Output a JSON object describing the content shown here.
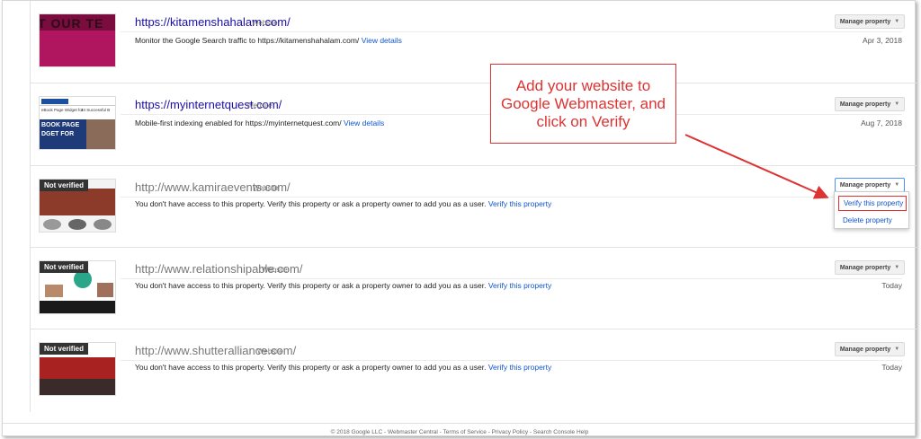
{
  "properties": [
    {
      "url": "https://kitamenshahalam.com/",
      "type": "Website",
      "verified": true,
      "message": "Monitor the Google Search traffic to https://kitamenshahalam.com/",
      "link": "View details",
      "date": "Apr 3, 2018",
      "button": "Manage property",
      "thumb_text": "T OUR TE"
    },
    {
      "url": "https://myinternetquest.com/",
      "type": "Website",
      "verified": true,
      "message": "Mobile-first indexing enabled for https://myinternetquest.com/",
      "link": "View details",
      "date": "Aug 7, 2018",
      "button": "Manage property",
      "thumb_text_1": "eBook Page Widget for",
      "thumb_text_2": "34 Successful B",
      "thumb_text_3": "BOOK PAGE",
      "thumb_text_4": "DGET FOR"
    },
    {
      "url": "http://www.kamiraevents.com/",
      "type": "Website",
      "verified": false,
      "badge": "Not verified",
      "message": "You don't have access to this property. Verify this property or ask a property owner to add you as a user.",
      "link": "Verify this property",
      "date": "",
      "button": "Manage property"
    },
    {
      "url": "http://www.relationshipable.com/",
      "type": "Website",
      "verified": false,
      "badge": "Not verified",
      "message": "You don't have access to this property. Verify this property or ask a property owner to add you as a user.",
      "link": "Verify this property",
      "date": "Today",
      "button": "Manage property"
    },
    {
      "url": "http://www.shutteralliance.com/",
      "type": "Website",
      "verified": false,
      "badge": "Not verified",
      "message": "You don't have access to this property. Verify this property or ask a property owner to add you as a user.",
      "link": "Verify this property",
      "date": "Today",
      "button": "Manage property"
    }
  ],
  "dropdown": {
    "items": [
      "Verify this property",
      "Delete property"
    ]
  },
  "callout": {
    "text": "Add your  website to Google Webmaster, and click on Verify"
  },
  "footer": {
    "text": "© 2018 Google LLC - Webmaster Central - Terms of Service - Privacy Policy - Search Console Help"
  },
  "colors": {
    "link": "#1155cc",
    "verified_url": "#1a0dab",
    "annotation": "#dd3333"
  },
  "icons": {
    "caret": "dropdown-caret-icon",
    "arrow": "annotation-arrow-icon"
  }
}
